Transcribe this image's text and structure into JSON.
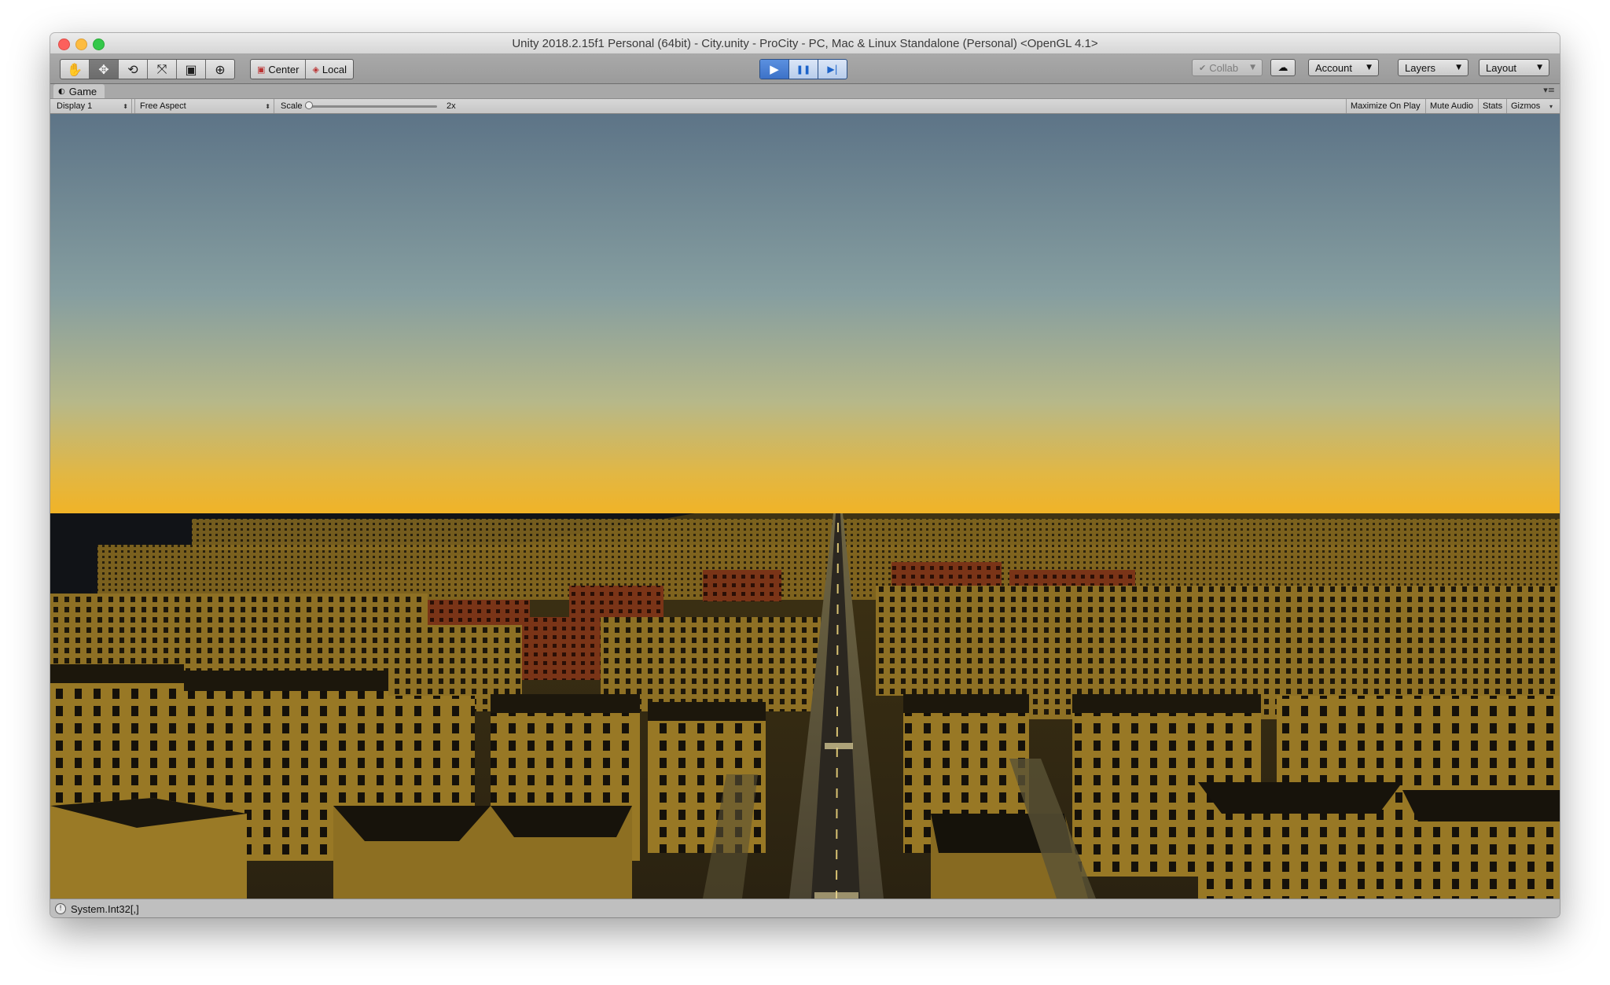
{
  "window": {
    "title": "Unity 2018.2.15f1 Personal (64bit) - City.unity - ProCity - PC, Mac & Linux Standalone (Personal) <OpenGL 4.1>"
  },
  "toolbar": {
    "transform_tools": [
      {
        "name": "hand-tool-icon",
        "glyph": "✋"
      },
      {
        "name": "move-tool-icon",
        "glyph": "✥"
      },
      {
        "name": "rotate-tool-icon",
        "glyph": "⟲"
      },
      {
        "name": "scale-tool-icon",
        "glyph": "⤧"
      },
      {
        "name": "rect-tool-icon",
        "glyph": "▣"
      },
      {
        "name": "transform-tool-icon",
        "glyph": "⊕"
      }
    ],
    "pivot_center_label": "Center",
    "pivot_local_label": "Local",
    "play_controls": [
      {
        "name": "play-icon",
        "glyph": "▶"
      },
      {
        "name": "pause-icon",
        "glyph": "❚❚"
      },
      {
        "name": "step-icon",
        "glyph": "▶|"
      }
    ],
    "collab_label": "Collab",
    "account_label": "Account",
    "layers_label": "Layers",
    "layout_label": "Layout"
  },
  "game_tab": {
    "label": "Game"
  },
  "game_bar": {
    "display_label": "Display 1",
    "aspect_label": "Free Aspect",
    "scale_label": "Scale",
    "scale_value_label": "2x",
    "scale_level": 0.0,
    "maximize_on_play_label": "Maximize On Play",
    "mute_audio_label": "Mute Audio",
    "stats_label": "Stats",
    "gizmos_label": "Gizmos"
  },
  "status": {
    "message": "System.Int32[,]"
  },
  "colors": {
    "accent_play": "#3d72c8",
    "sky_top": "#5f7687",
    "sky_horizon": "#efb42a",
    "building": "#8c6f24",
    "brick": "#7a3417"
  }
}
